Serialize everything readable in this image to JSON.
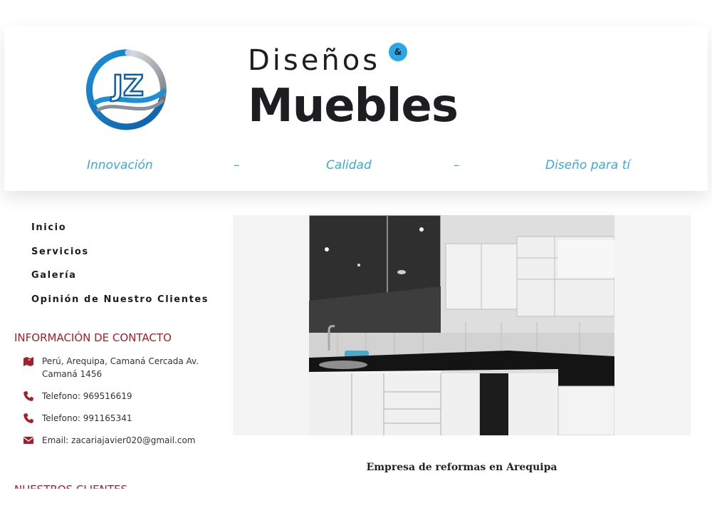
{
  "brand": {
    "logo_text": "JZ",
    "line1": "Diseños",
    "amp": "&",
    "line2": "Muebles"
  },
  "taglines": [
    "Innovación",
    "–",
    "Calidad",
    "–",
    "Diseño para tí"
  ],
  "nav": {
    "items": [
      {
        "label": "Inicio"
      },
      {
        "label": "Servicios"
      },
      {
        "label": "Galería"
      },
      {
        "label": "Opinión de Nuestro Clientes"
      }
    ]
  },
  "contact": {
    "heading": "INFORMACIÓN DE CONTACTO",
    "address": "Perú, Arequipa, Camaná Cercada Av. Camaná 1456",
    "phone1": "Telefono: 969516619",
    "phone2": "Telefono: 991165341",
    "email": "Email: zacariajavier020@gmail.com"
  },
  "clients": {
    "heading": "NUESTROS CLIENTES"
  },
  "main": {
    "section_title": "Empresa de reformas en Arequipa"
  },
  "colors": {
    "accent_blue": "#3fa6e0",
    "heading_red": "#a3202a",
    "brand_dark": "#1d1d22"
  }
}
